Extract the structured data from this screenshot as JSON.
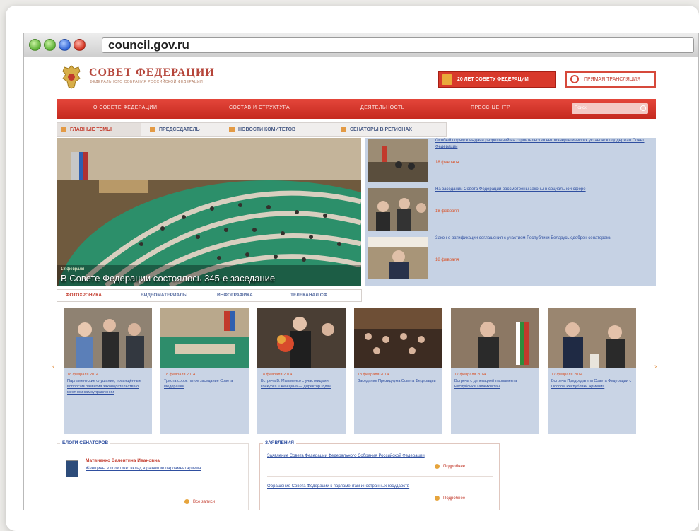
{
  "browser": {
    "url": "council.gov.ru"
  },
  "header": {
    "logo_title": "СОВЕТ ФЕДЕРАЦИИ",
    "logo_subtitle": "ФЕДЕРАЛЬНОГО СОБРАНИЯ РОССИЙСКОЙ ФЕДЕРАЦИИ",
    "btn_primary": "20 ЛЕТ СОВЕТУ ФЕДЕРАЦИИ",
    "btn_secondary": "ПРЯМАЯ ТРАНСЛЯЦИЯ"
  },
  "nav": {
    "items": [
      "О СОВЕТЕ ФЕДЕРАЦИИ",
      "СОСТАВ И СТРУКТУРА",
      "ДЕЯТЕЛЬНОСТЬ",
      "ПРЕСС-ЦЕНТР"
    ],
    "search_placeholder": "Поиск"
  },
  "tabs": [
    {
      "label": "ГЛАВНЫЕ ТЕМЫ"
    },
    {
      "label": "ПРЕДСЕДАТЕЛЬ"
    },
    {
      "label": "НОВОСТИ КОМИТЕТОВ"
    },
    {
      "label": "СЕНАТОРЫ В РЕГИОНАХ"
    }
  ],
  "hero": {
    "small_caption": "18 февраля",
    "caption": "В Совете Федерации состоялось 345-е заседание"
  },
  "news": [
    {
      "title": "Особый порядок выдачи разрешений на строительство ветроэнергетических установок поддержал Совет Федерации",
      "date": "18 февраля"
    },
    {
      "title": "На заседании Совета Федерации рассмотрены законы в социальной сфере",
      "date": "18 февраля"
    },
    {
      "title": "Закон о ратификации соглашения с участием Республики Беларусь одобрен сенаторами",
      "date": "18 февраля"
    }
  ],
  "media_tabs": [
    "ФОТОХРОНИКА",
    "ВИДЕОМАТЕРИАЛЫ",
    "ИНФОГРАФИКА",
    "ТЕЛЕКАНАЛ СФ"
  ],
  "gallery": [
    {
      "date": "18 февраля 2014",
      "text": "Парламентские слушания, посвящённые вопросам развития законодательства о местном самоуправлении"
    },
    {
      "date": "18 февраля 2014",
      "text": "Триста сорок пятое заседание Совета Федерации"
    },
    {
      "date": "18 февраля 2014",
      "text": "Встреча В. Матвиенко с участницами конкурса «Женщина — директор года»"
    },
    {
      "date": "18 февраля 2014",
      "text": "Заседание Президиума Совета Федерации"
    },
    {
      "date": "17 февраля 2014",
      "text": "Встреча с делегацией парламента Республики Таджикистан"
    },
    {
      "date": "17 февраля 2014",
      "text": "Встреча Председателя Совета Федерации с Послом Республики Армения"
    }
  ],
  "blog": {
    "title": "БЛОГИ СЕНАТОРОВ",
    "author": "Матвиенко Валентина Ивановна",
    "text": "Женщины в политике: вклад в развитие парламентаризма",
    "more": "Все записи"
  },
  "statements": {
    "title": "ЗАЯВЛЕНИЯ",
    "items": [
      {
        "text": "Заявление Совета Федерации Федерального Собрания Российской Федерации",
        "more": "Подробнее"
      },
      {
        "text": "Обращение Совета Федерации к парламентам иностранных государств",
        "more": "Подробнее"
      }
    ]
  },
  "colors": {
    "brand_red": "#d8392b",
    "link_blue": "#2f4fa0",
    "panel_blue": "#c6d2e4"
  },
  "icons": [
    "emblem-icon",
    "chevron-left-icon",
    "chevron-right-icon",
    "search-icon",
    "broadcast-icon"
  ]
}
